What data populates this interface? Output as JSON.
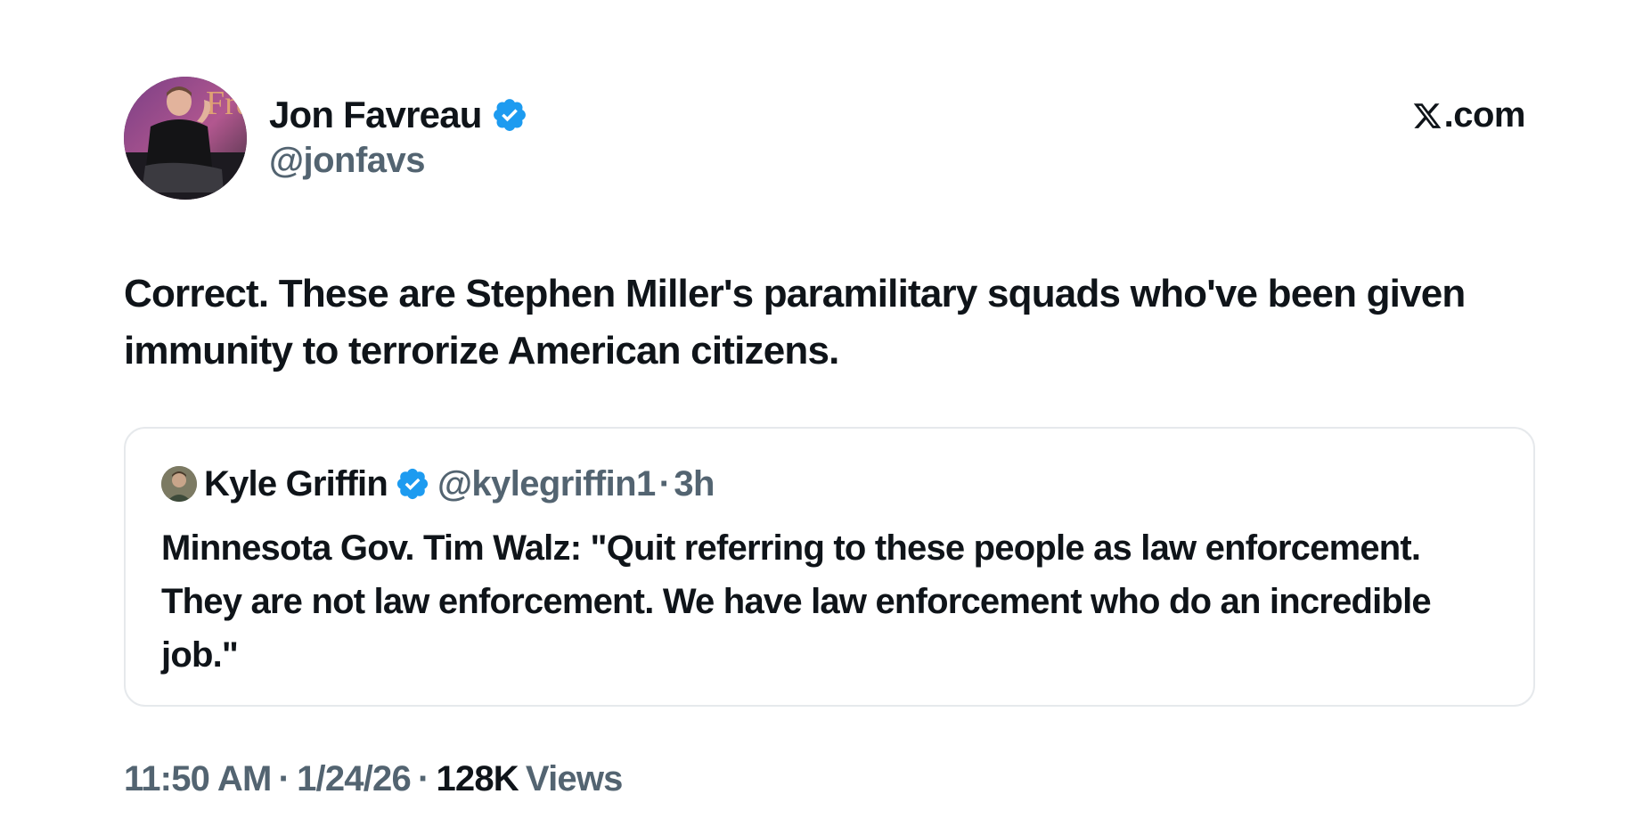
{
  "site": {
    "label": ".com",
    "logo_icon": "x-logo-icon"
  },
  "author": {
    "name": "Jon Favreau",
    "handle": "@jonfavs",
    "verified": true,
    "avatar_icon": "avatar-photo"
  },
  "tweet": {
    "text": "Correct. These are Stephen Miller's paramilitary squads who've been given immunity to terrorize American citizens."
  },
  "quote": {
    "author_name": "Kyle Griffin",
    "handle": "@kylegriffin1",
    "separator": "·",
    "time": "3h",
    "verified": true,
    "text": "Minnesota Gov. Tim Walz: \"Quit referring to these people as law enforcement. They are not law enforcement. We have law enforcement who do an incredible job.\""
  },
  "meta": {
    "time": "11:50 AM",
    "separator": "·",
    "date": "1/24/26",
    "views_count": "128K",
    "views_label": "Views"
  },
  "colors": {
    "primary_text": "#0f1419",
    "secondary_text": "#536471",
    "verified_blue": "#1d9bf0",
    "border": "#e6e9ec"
  }
}
